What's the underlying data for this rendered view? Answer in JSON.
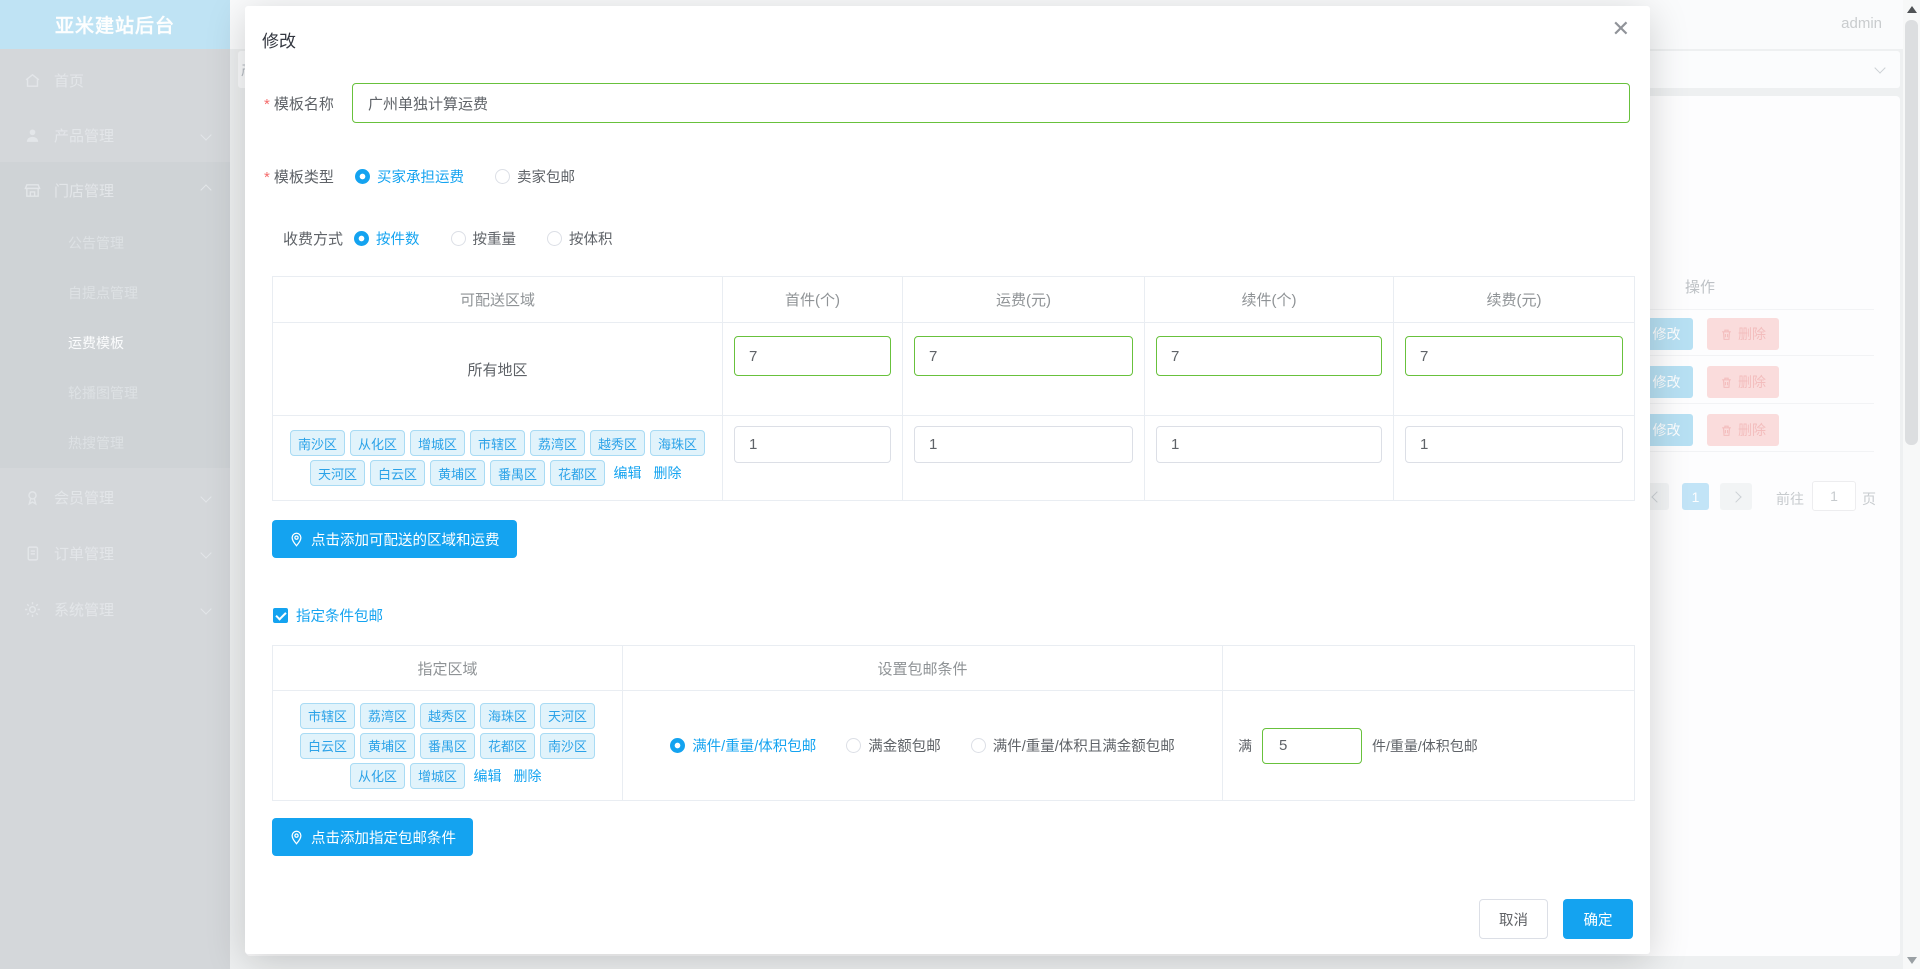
{
  "colors": {
    "primary": "#14a3f0",
    "success": "#67c23a",
    "tag_text": "#2ba2e8",
    "logo_bg": "#bfe3f4"
  },
  "header": {
    "username": "admin"
  },
  "sidebar": {
    "logo": "亚米建站后台",
    "items": [
      {
        "label": "首页",
        "icon": "home-icon"
      },
      {
        "label": "产品管理",
        "icon": "user-icon"
      },
      {
        "label": "门店管理",
        "icon": "store-icon",
        "children": [
          "公告管理",
          "自提点管理",
          "运费模板",
          "轮播图管理",
          "热搜管理"
        ],
        "active_child": "运费模板"
      },
      {
        "label": "会员管理",
        "icon": "medal-icon"
      },
      {
        "label": "订单管理",
        "icon": "document-icon"
      },
      {
        "label": "系统管理",
        "icon": "gear-icon"
      }
    ]
  },
  "background": {
    "partial_text": "产",
    "table": {
      "operation_header": "操作",
      "rows": [
        {
          "edit": "修改",
          "delete": "删除"
        },
        {
          "edit": "修改",
          "delete": "删除"
        },
        {
          "edit": "修改",
          "delete": "删除"
        }
      ]
    },
    "pagination": {
      "current": "1",
      "goto_label": "前往",
      "page_input": "1",
      "unit": "页"
    }
  },
  "modal": {
    "title": "修改",
    "required_mark": "*",
    "fields": {
      "template_name": {
        "label": "模板名称",
        "value": "广州单独计算运费"
      },
      "template_type": {
        "label": "模板类型",
        "options": [
          "买家承担运费",
          "卖家包邮"
        ],
        "selected": "买家承担运费"
      },
      "charge_method": {
        "label": "收费方式",
        "options": [
          "按件数",
          "按重量",
          "按体积"
        ],
        "selected": "按件数"
      }
    },
    "shipping_table": {
      "headers": [
        "可配送区域",
        "首件(个)",
        "运费(元)",
        "续件(个)",
        "续费(元)"
      ],
      "rows": [
        {
          "region": "所有地区",
          "values": [
            "7",
            "7",
            "7",
            "7"
          ]
        },
        {
          "region_tags": [
            "南沙区",
            "从化区",
            "增城区",
            "市辖区",
            "荔湾区",
            "越秀区",
            "海珠区",
            "天河区",
            "白云区",
            "黄埔区",
            "番禺区",
            "花都区"
          ],
          "edit": "编辑",
          "delete": "删除",
          "values": [
            "1",
            "1",
            "1",
            "1"
          ]
        }
      ]
    },
    "add_region_button": "点击添加可配送的区域和运费",
    "free_shipping_checkbox": {
      "label": "指定条件包邮",
      "checked": true
    },
    "condition_table": {
      "headers": [
        "指定区域",
        "设置包邮条件",
        ""
      ],
      "row": {
        "region_tags": [
          "市辖区",
          "荔湾区",
          "越秀区",
          "海珠区",
          "天河区",
          "白云区",
          "黄埔区",
          "番禺区",
          "花都区",
          "南沙区",
          "从化区",
          "增城区"
        ],
        "edit": "编辑",
        "delete": "删除",
        "options": [
          "满件/重量/体积包邮",
          "满金额包邮",
          "满件/重量/体积且满金额包邮"
        ],
        "selected": "满件/重量/体积包邮",
        "threshold_prefix": "满",
        "threshold_value": "5",
        "threshold_suffix": "件/重量/体积包邮"
      }
    },
    "add_condition_button": "点击添加指定包邮条件",
    "footer": {
      "cancel": "取消",
      "confirm": "确定"
    }
  }
}
